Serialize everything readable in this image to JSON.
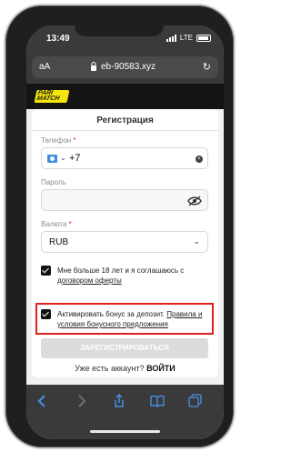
{
  "status": {
    "time": "13:49",
    "network": "LTE"
  },
  "browser": {
    "aa_label": "aA",
    "domain": "eb-90583.xyz"
  },
  "brand": {
    "logo_text": "PARI MATCH",
    "accent": "#f5e50b"
  },
  "form": {
    "title": "Регистрация",
    "phone_label": "Телефон",
    "phone_prefix": "+7",
    "password_label": "Пароль",
    "currency_label": "Валюта",
    "currency_value": "RUB",
    "required_mark": "*",
    "age_consent_text": "Мне больше 18 лет и я соглашаюсь с ",
    "age_consent_link": "договором оферты",
    "bonus_text": "Активировать бонус за депозит. ",
    "bonus_link": "Правила и условия бонусного предложения",
    "submit_label": "ЗАРЕГИСТРИРОВАТЬСЯ",
    "have_account": "Уже есть аккаунт?",
    "login_label": "ВОЙТИ"
  },
  "colors": {
    "highlight": "#e02020",
    "toolbar_icon": "#4a90e2"
  }
}
